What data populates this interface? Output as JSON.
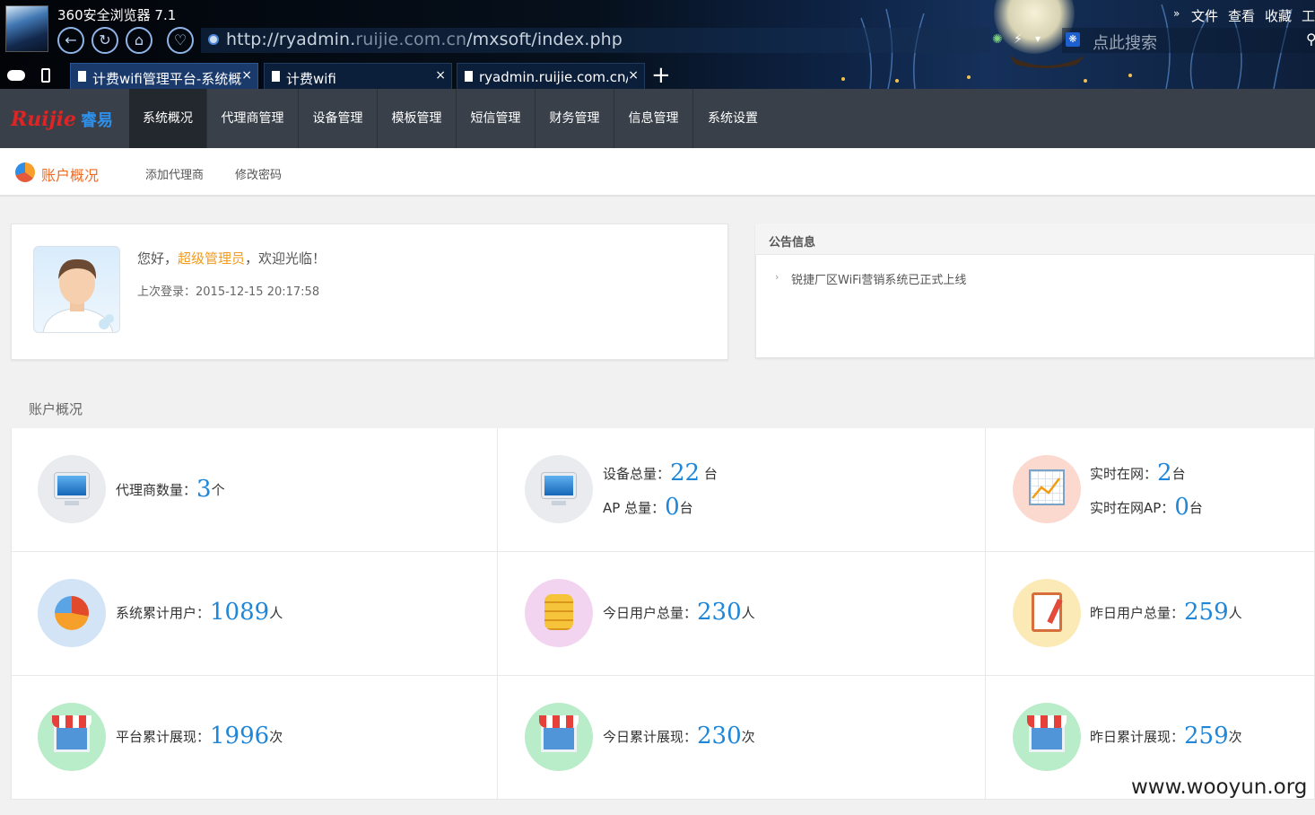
{
  "browser": {
    "title": "360安全浏览器 7.1",
    "url_prefix": "http://ryadmin.",
    "url_domain": "ruijie.com.cn",
    "url_path": "/mxsoft/index.php",
    "search_placeholder": "点此搜索",
    "menu_more": "»",
    "menu": [
      "文件",
      "查看",
      "收藏",
      "工"
    ],
    "nav_icons": [
      "back-icon",
      "refresh-icon",
      "home-icon",
      "favorite-icon"
    ],
    "tabs": [
      {
        "title": "计费wifi管理平台-系统概",
        "close": "×",
        "active": true
      },
      {
        "title": "计费wifi",
        "close": "×",
        "active": false
      },
      {
        "title": "ryadmin.ruijie.com.cn/r",
        "close": "×",
        "active": false
      }
    ],
    "new_tab": "+"
  },
  "header": {
    "brand_logo": "Ruijie",
    "brand_product": "睿易",
    "nav": [
      "系统概况",
      "代理商管理",
      "设备管理",
      "模板管理",
      "短信管理",
      "财务管理",
      "信息管理",
      "系统设置"
    ],
    "active_nav": "系统概况"
  },
  "subnav": {
    "current": "账户概况",
    "links": [
      "添加代理商",
      "修改密码"
    ]
  },
  "welcome": {
    "greeting_prefix": "您好，",
    "user_role": "超级管理员",
    "greeting_suffix": "，欢迎光临！",
    "last_login_label": "上次登录：",
    "last_login_time": "2015-12-15 20:17:58"
  },
  "notice": {
    "title": "公告信息",
    "bullet": "›",
    "items": [
      "锐捷厂区WiFi营销系统已正式上线"
    ]
  },
  "overview": {
    "title": "账户概况",
    "stats": {
      "agents": {
        "label": "代理商数量：",
        "value": "3",
        "unit": "个"
      },
      "devices_total": {
        "label": "设备总量：",
        "value": "22",
        "unit": " 台"
      },
      "ap_total": {
        "label": "AP 总量：",
        "value": "0",
        "unit": "台"
      },
      "online_now": {
        "label": "实时在网：",
        "value": "2",
        "unit": "台"
      },
      "online_ap": {
        "label": "实时在网AP：",
        "value": "0",
        "unit": "台"
      },
      "system_users": {
        "label": "系统累计用户：",
        "value": "1089",
        "unit": "人"
      },
      "today_users": {
        "label": "今日用户总量：",
        "value": "230",
        "unit": "人"
      },
      "yesterday_users": {
        "label": "昨日用户总量：",
        "value": "259",
        "unit": "人"
      },
      "platform_impressions": {
        "label": "平台累计展现：",
        "value": "1996",
        "unit": "次"
      },
      "today_impressions": {
        "label": "今日累计展现：",
        "value": "230",
        "unit": "次"
      },
      "yesterday_impressions": {
        "label": "昨日累计展现：",
        "value": "259",
        "unit": "次"
      }
    }
  },
  "watermark": "www.wooyun.org",
  "colors": {
    "accent_blue": "#1f86d8",
    "accent_orange": "#ee6b24",
    "header_bg": "#394049",
    "role_highlight": "#f29b1d"
  }
}
